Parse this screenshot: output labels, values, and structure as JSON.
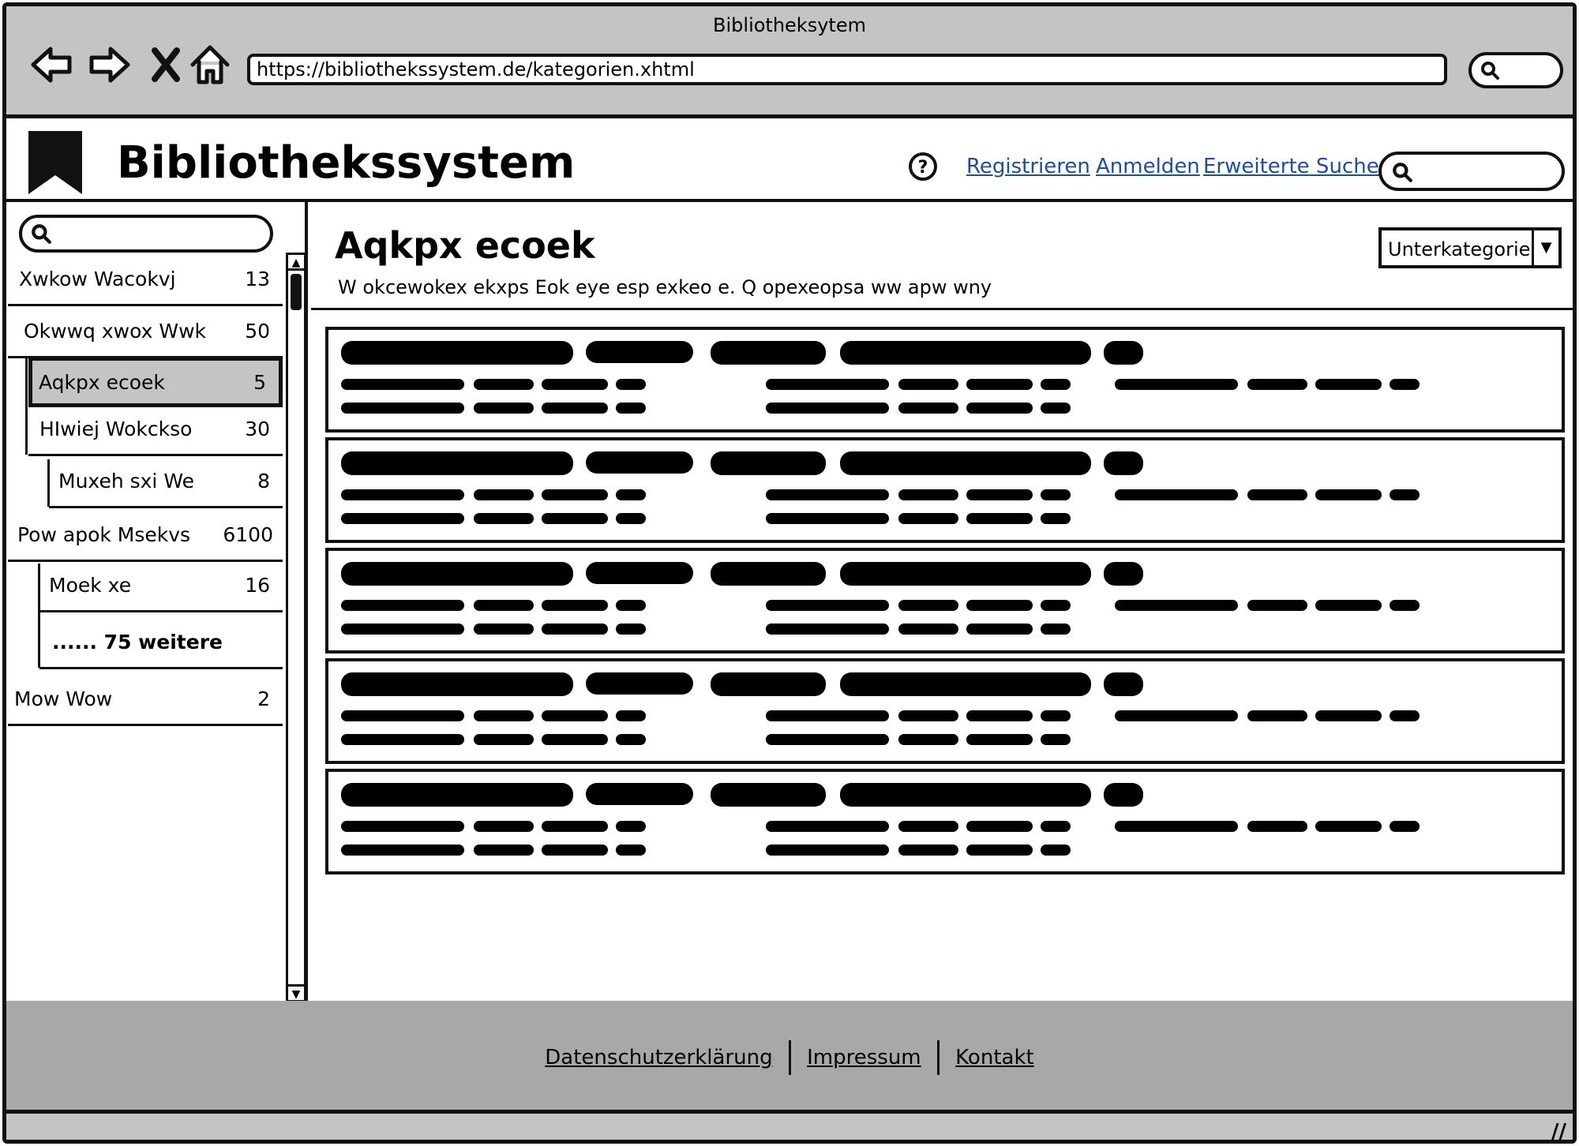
{
  "browser": {
    "window_title": "Bibliotheksytem",
    "url": "https://bibliothekssystem.de/kategorien.xhtml",
    "nav_icons": [
      "back-icon",
      "forward-icon",
      "stop-icon",
      "home-icon"
    ]
  },
  "header": {
    "site_title": "Bibliothekssystem",
    "links": {
      "register": "Registrieren",
      "login": "Anmelden",
      "advanced_search": "Erweiterte Suche"
    }
  },
  "sidebar": {
    "categories": [
      {
        "label": "Xwkow Wacokvj",
        "count": "13"
      },
      {
        "label": "Okwwq xwox Wwk",
        "count": "50"
      },
      {
        "label": "Aqkpx ecoek",
        "count": "5",
        "selected": true
      },
      {
        "label": "HIwiej Wokckso",
        "count": "30"
      },
      {
        "label": "Muxeh sxi We",
        "count": "8"
      },
      {
        "label": "Pow apok Msekvs",
        "count": "6100"
      },
      {
        "label": "Moek xe",
        "count": "16"
      },
      {
        "label": "...... 75 weitere",
        "count": ""
      },
      {
        "label": "Mow Wow",
        "count": "2"
      }
    ]
  },
  "main": {
    "heading": "Aqkpx ecoek",
    "description": "W okcewokex ekxps Eok eye esp exkeo e. Q opexeopsa ww apw wny",
    "subcategory_select": "Unterkategorie"
  },
  "footer": {
    "privacy": "Datenschutzerklärung",
    "imprint": "Impressum",
    "contact": "Kontakt"
  }
}
